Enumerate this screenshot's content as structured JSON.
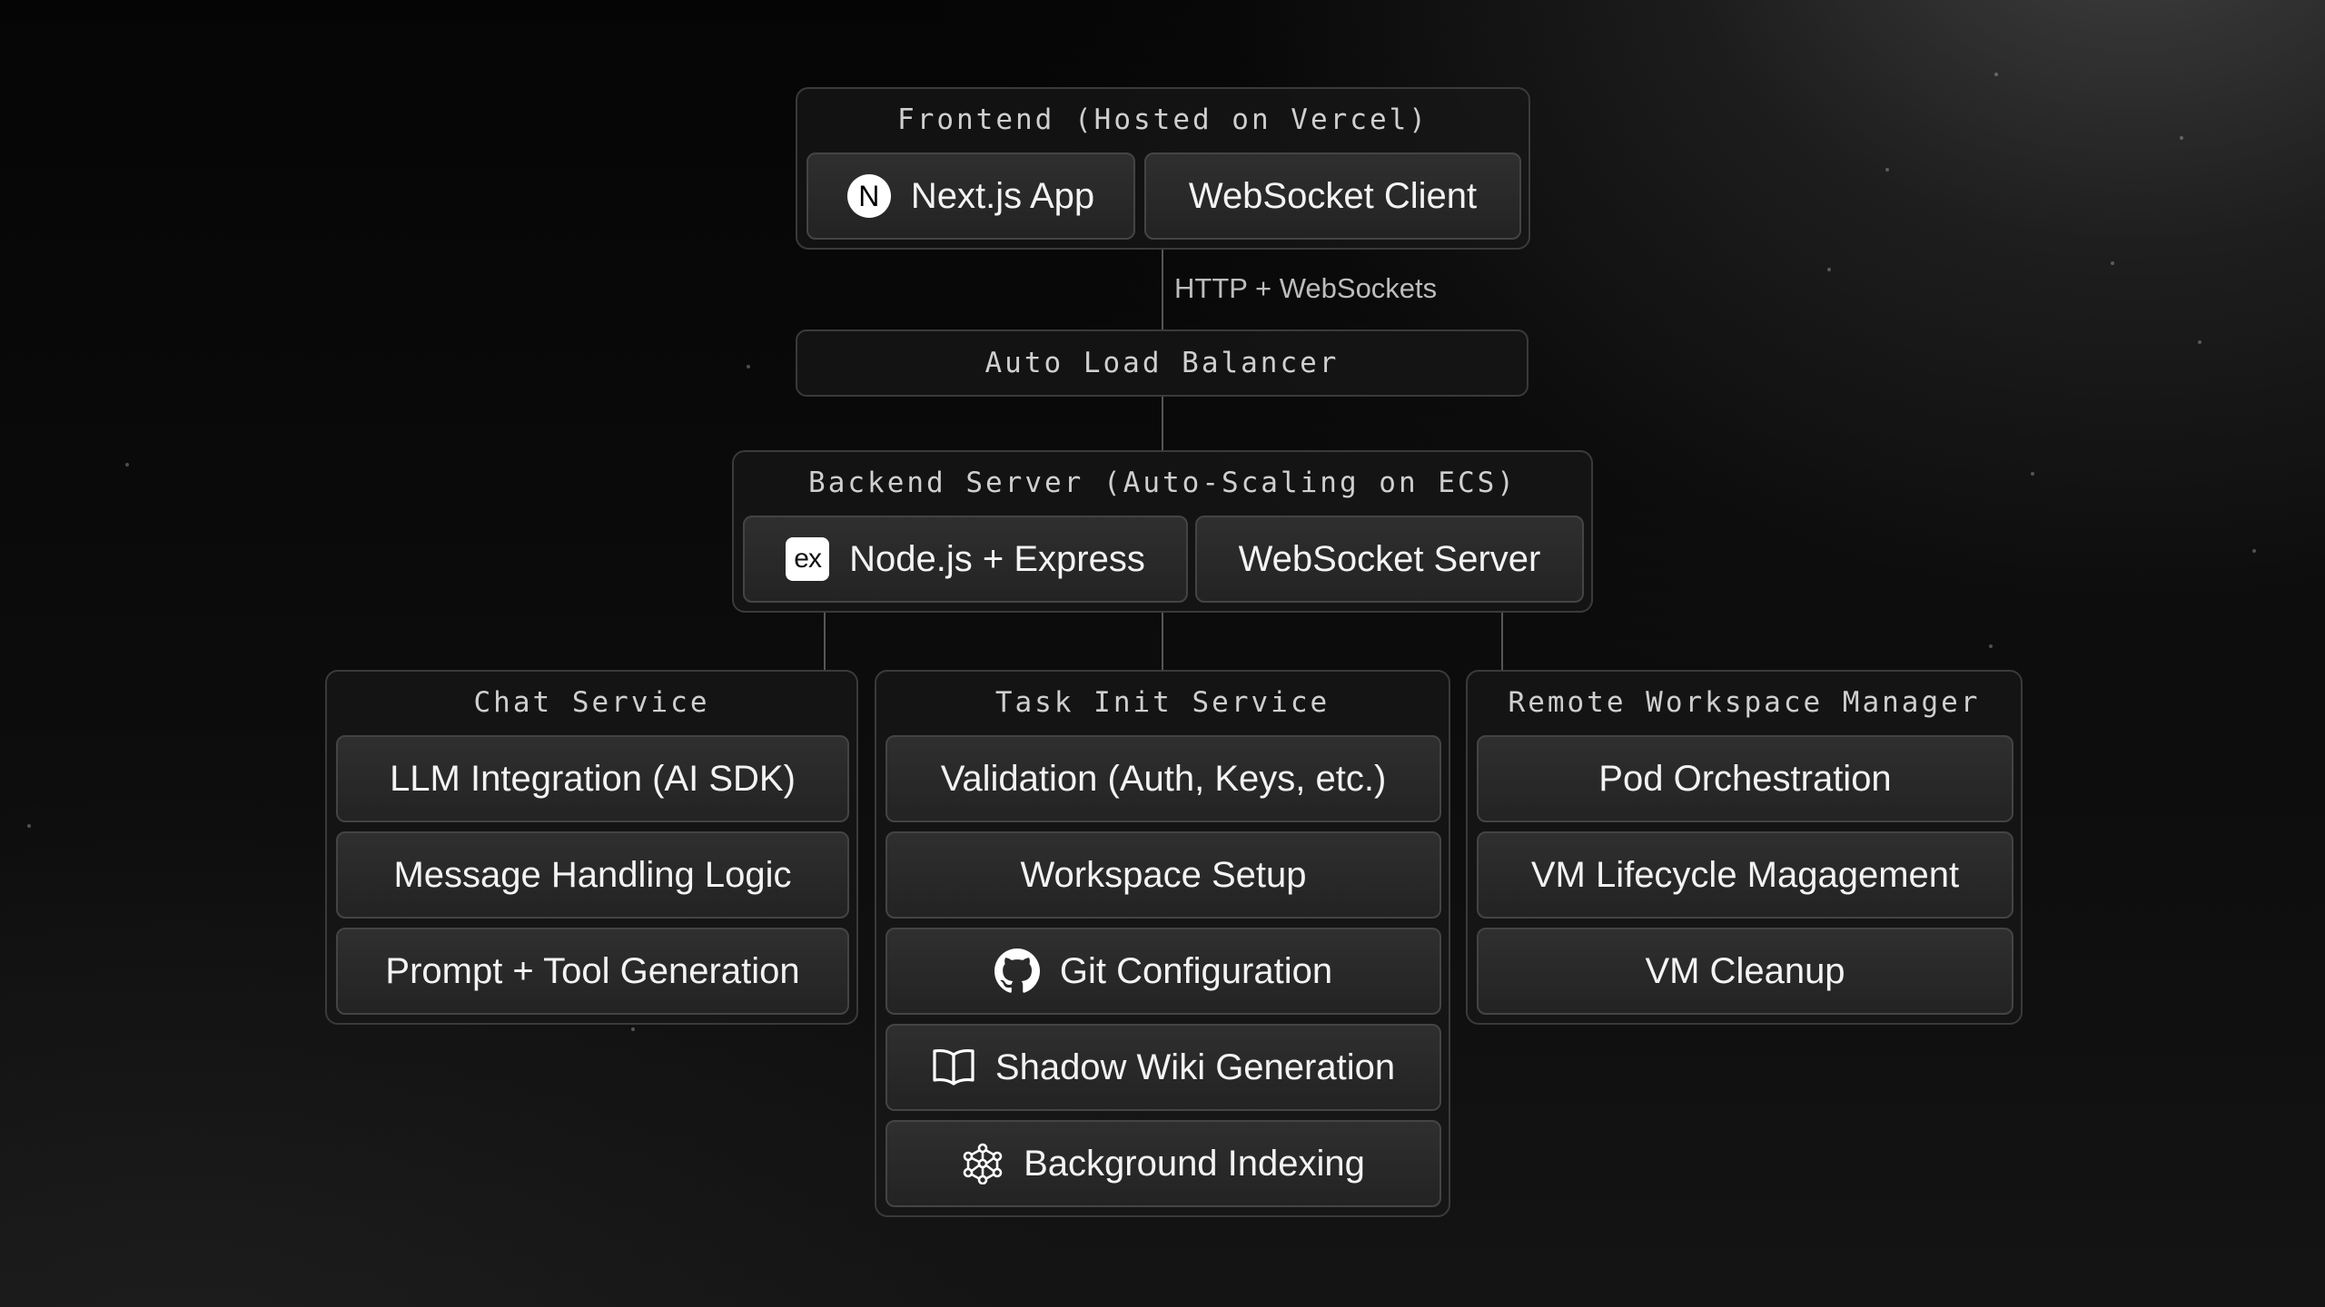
{
  "frontend": {
    "title": "Frontend (Hosted on Vercel)",
    "items": [
      {
        "label": "Next.js App",
        "icon": "nextjs-logo-icon",
        "logo_text": "N"
      },
      {
        "label": "WebSocket Client"
      }
    ]
  },
  "edge_label": "HTTP + WebSockets",
  "load_balancer": {
    "label": "Auto Load Balancer"
  },
  "backend": {
    "title": "Backend Server (Auto-Scaling on ECS)",
    "items": [
      {
        "label": "Node.js + Express",
        "icon": "express-logo-icon",
        "logo_text": "ex"
      },
      {
        "label": "WebSocket Server"
      }
    ]
  },
  "chat_service": {
    "title": "Chat Service",
    "items": [
      {
        "label": "LLM Integration (AI SDK)"
      },
      {
        "label": "Message Handling Logic"
      },
      {
        "label": "Prompt + Tool Generation"
      }
    ]
  },
  "task_init_service": {
    "title": "Task Init Service",
    "items": [
      {
        "label": "Validation (Auth, Keys, etc.)"
      },
      {
        "label": "Workspace Setup"
      },
      {
        "label": "Git Configuration",
        "icon": "github-icon"
      },
      {
        "label": "Shadow Wiki Generation",
        "icon": "book-icon"
      },
      {
        "label": "Background Indexing",
        "icon": "network-icon"
      }
    ]
  },
  "remote_workspace_manager": {
    "title": "Remote Workspace Manager",
    "items": [
      {
        "label": "Pod Orchestration"
      },
      {
        "label": "VM Lifecycle Magagement"
      },
      {
        "label": "VM Cleanup"
      }
    ]
  },
  "colors": {
    "background": "#0b0b0b",
    "box_fill": "#2a2a2a",
    "border": "#444444",
    "text": "#f3f3f3",
    "muted_text": "#cfcfcf"
  }
}
